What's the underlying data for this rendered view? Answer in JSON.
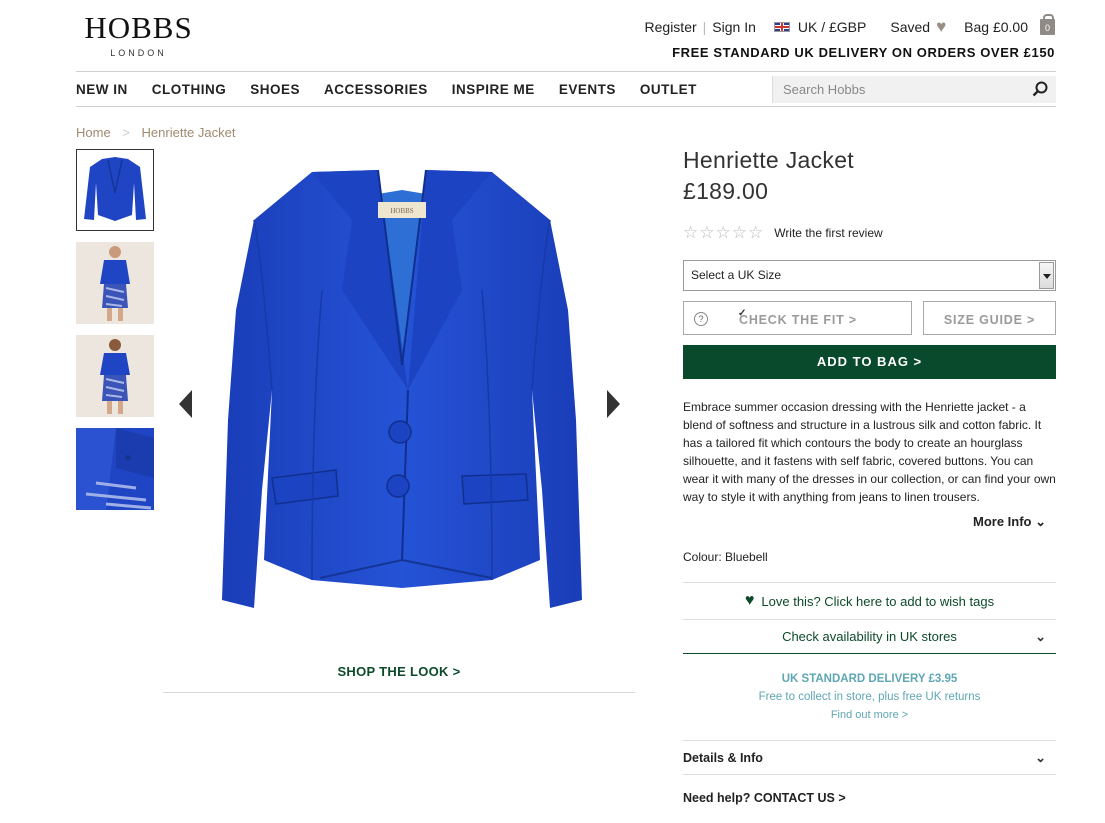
{
  "header": {
    "logo_main": "HOBBS",
    "logo_sub": "LONDON",
    "register": "Register",
    "sign_in": "Sign In",
    "currency": "UK / £GBP",
    "saved": "Saved",
    "bag": "Bag £0.00",
    "bag_count": "0",
    "promo": "FREE STANDARD UK DELIVERY ON ORDERS OVER £150"
  },
  "nav": {
    "items": [
      "NEW IN",
      "CLOTHING",
      "SHOES",
      "ACCESSORIES",
      "INSPIRE ME",
      "EVENTS",
      "OUTLET"
    ],
    "search_placeholder": "Search Hobbs"
  },
  "breadcrumb": [
    "Home",
    "Henriette Jacket"
  ],
  "gallery": {
    "shop_the_look": "SHOP THE LOOK >",
    "label_on_collar": "HOBBS"
  },
  "product": {
    "title": "Henriette Jacket",
    "price": "£189.00",
    "stars": "☆☆☆☆☆",
    "review_link": "Write the first review",
    "size_select": "Select a UK Size",
    "check_fit": "CHECK THE FIT >",
    "help_icon": "?",
    "size_guide": "SIZE GUIDE >",
    "add_to_bag": "ADD TO BAG >",
    "description": "Embrace summer occasion dressing with the Henriette jacket - a blend of softness and structure in a lustrous silk and cotton fabric. It has a tailored fit which contours the body to create an hourglass silhouette, and it fastens with self fabric, covered buttons. You can wear it with many of the dresses in our collection, or can find your own way to style it with anything from jeans to linen trousers.",
    "more_info": "More Info",
    "colour": "Colour: Bluebell",
    "wish": "Love this? Click here to add to wish tags",
    "availability": "Check availability in UK stores",
    "delivery_line1": "UK STANDARD DELIVERY £3.95",
    "delivery_line2": "Free to collect in store, plus free UK returns",
    "delivery_line3": "Find out more >",
    "details": "Details & Info",
    "help": "Need help? CONTACT US >"
  },
  "colors": {
    "brand_green": "#0a4a2c",
    "jacket_blue": "#1f45c4",
    "breadcrumb": "#a08a70",
    "delivery_teal": "#5ea6b3"
  },
  "icons": [
    "search-icon",
    "heart-icon",
    "bag-icon",
    "flag-icon",
    "chevron-down-icon",
    "arrow-left-icon",
    "arrow-right-icon",
    "help-icon",
    "star-icon"
  ]
}
